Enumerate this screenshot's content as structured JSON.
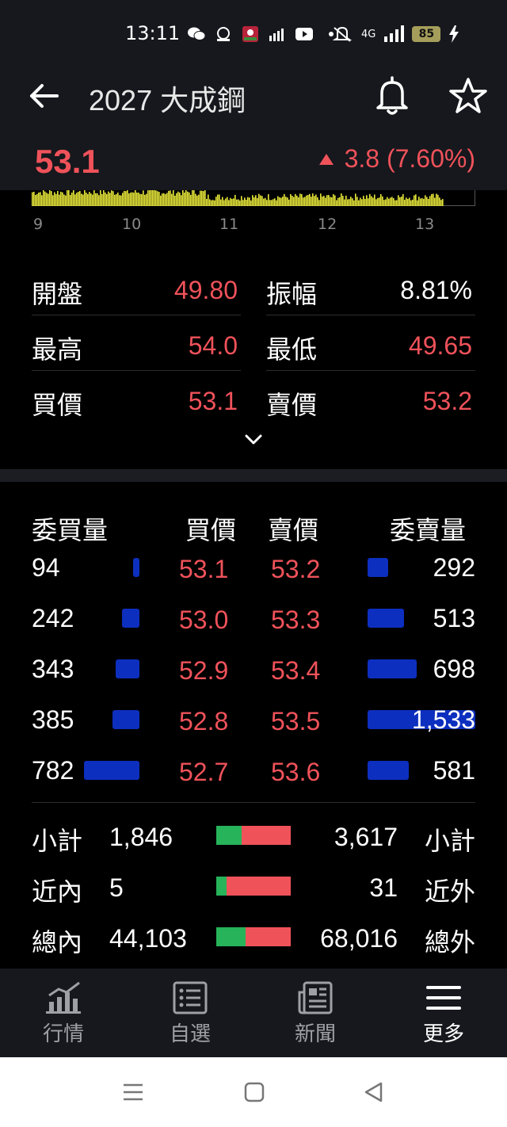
{
  "status_bar": {
    "time": "13:11",
    "network": "4G",
    "battery": "85"
  },
  "header": {
    "title": "2027 大成鋼",
    "price": "53.1",
    "change": "3.8 (7.60%)"
  },
  "intraday": {
    "time_ticks": [
      "9",
      "10",
      "11",
      "12",
      "13"
    ]
  },
  "stats": [
    {
      "label": "開盤",
      "value": "49.80",
      "color": "red"
    },
    {
      "label": "振幅",
      "value": "8.81%",
      "color": "white"
    },
    {
      "label": "最高",
      "value": "54.0",
      "color": "red"
    },
    {
      "label": "最低",
      "value": "49.65",
      "color": "red"
    },
    {
      "label": "買價",
      "value": "53.1",
      "color": "red"
    },
    {
      "label": "賣價",
      "value": "53.2",
      "color": "red"
    }
  ],
  "orderbook": {
    "headers": {
      "bid_qty": "委買量",
      "bid": "買價",
      "ask": "賣價",
      "ask_qty": "委賣量"
    },
    "rows": [
      {
        "bid_qty": "94",
        "bid": "53.1",
        "ask": "53.2",
        "ask_qty": "292"
      },
      {
        "bid_qty": "242",
        "bid": "53.0",
        "ask": "53.3",
        "ask_qty": "513"
      },
      {
        "bid_qty": "343",
        "bid": "52.9",
        "ask": "53.4",
        "ask_qty": "698"
      },
      {
        "bid_qty": "385",
        "bid": "52.8",
        "ask": "53.5",
        "ask_qty": "1,533"
      },
      {
        "bid_qty": "782",
        "bid": "52.7",
        "ask": "53.6",
        "ask_qty": "581"
      }
    ]
  },
  "summary": [
    {
      "left_label": "小計",
      "left_value": "1,846",
      "right_value": "3,617",
      "right_label": "小計",
      "buy_share": 0.338
    },
    {
      "left_label": "近內",
      "left_value": "5",
      "right_value": "31",
      "right_label": "近外",
      "buy_share": 0.139
    },
    {
      "left_label": "總內",
      "left_value": "44,103",
      "right_value": "68,016",
      "right_label": "總外",
      "buy_share": 0.393
    }
  ],
  "tabs": [
    {
      "label": "行情",
      "active": false
    },
    {
      "label": "自選",
      "active": false
    },
    {
      "label": "新聞",
      "active": false
    },
    {
      "label": "更多",
      "active": true
    }
  ],
  "colors": {
    "up": "#f0525a",
    "bid_bar": "#0d2fbf",
    "buy_green": "#27b35a",
    "volume_bar": "#e8e83a"
  }
}
